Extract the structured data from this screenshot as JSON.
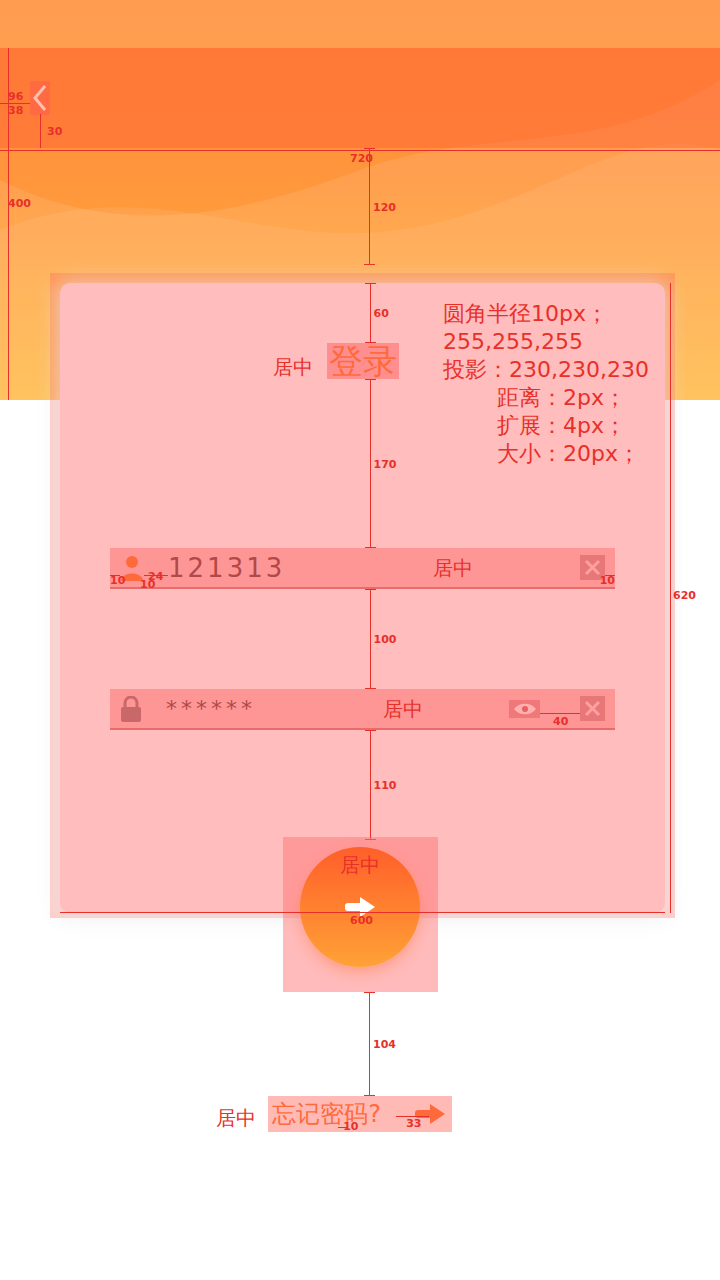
{
  "header": {
    "dimensions": {
      "nav_top": "96",
      "icon_height": "38",
      "icon_bottom": "30",
      "width": "720",
      "height": "400",
      "card_offset": "120"
    }
  },
  "card": {
    "title": "登录",
    "title_note": "居中",
    "spec": [
      {
        "text": "圆角半径10px；",
        "kind": "heading"
      },
      {
        "text": "255,255,255",
        "kind": "heading"
      },
      {
        "text": "投影：230,230,230",
        "kind": "heading"
      },
      {
        "text": "距离：2px；",
        "kind": "detail"
      },
      {
        "text": "扩展：4px；",
        "kind": "detail"
      },
      {
        "text": "大小：20px；",
        "kind": "detail"
      }
    ],
    "dimensions": {
      "title_top": "60",
      "title_gap": "170",
      "field_gap": "100",
      "button_gap": "110",
      "height": "620",
      "width": "600"
    }
  },
  "fields": [
    {
      "kind": "username",
      "value": "121313",
      "note": "居中",
      "dimensions": [
        "10",
        "24",
        "10",
        "10"
      ]
    },
    {
      "kind": "password",
      "value": "******",
      "note": "居中",
      "dimensions": [
        "40"
      ]
    }
  ],
  "submit": {
    "note": "居中"
  },
  "forgot": {
    "label": "忘记密码?",
    "note": "居中",
    "dimensions": {
      "top_gap": "104",
      "text_offset": "10",
      "arrow_gap": "33"
    }
  }
}
